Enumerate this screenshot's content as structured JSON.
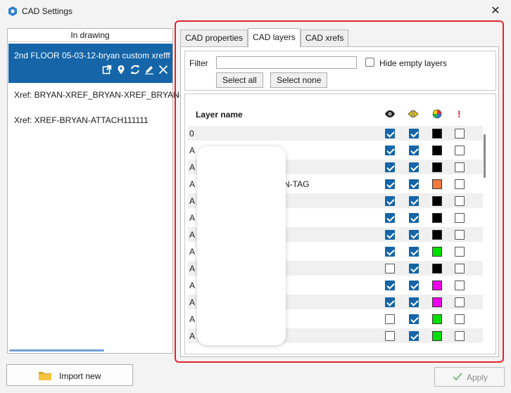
{
  "window": {
    "title": "CAD Settings",
    "close_glyph": "✕"
  },
  "left_panel": {
    "header": "In drawing",
    "selected_xref": "2nd FLOOR 05-03-12-bryan custom xrefff",
    "xref_items": [
      "Xref: BRYAN-XREF_BRYAN-XREF_BRYAN-",
      "Xref: XREF-BRYAN-ATTACH111111"
    ],
    "action_icons": [
      "open-external-icon",
      "locate-pin-icon",
      "reload-icon",
      "edit-pencil-icon",
      "remove-x-icon"
    ]
  },
  "tabs": [
    {
      "label": "CAD properties",
      "active": false
    },
    {
      "label": "CAD layers",
      "active": true
    },
    {
      "label": "CAD xrefs",
      "active": false
    }
  ],
  "filter": {
    "label": "Filter",
    "value": "",
    "hide_empty_label": "Hide empty layers",
    "hide_empty_checked": false,
    "select_all_label": "Select all",
    "select_none_label": "Select none"
  },
  "layers": {
    "header_name": "Layer name",
    "column_icons": [
      "visibility-eye-icon",
      "snap-arrows-icon",
      "color-wheel-icon",
      "warning-exclamation-icon"
    ],
    "rows": [
      {
        "name": "0",
        "visible": true,
        "snap": true,
        "color": "#000000",
        "flag": false
      },
      {
        "name": "A",
        "visible": true,
        "snap": true,
        "color": "#000000",
        "flag": false
      },
      {
        "name": "A",
        "visible": true,
        "snap": true,
        "color": "#000000",
        "flag": false
      },
      {
        "name": "A",
        "suffix": "EN-TAG",
        "visible": true,
        "snap": true,
        "color": "#f07a3a",
        "flag": false
      },
      {
        "name": "A",
        "visible": true,
        "snap": true,
        "color": "#000000",
        "flag": false
      },
      {
        "name": "A",
        "visible": true,
        "snap": true,
        "color": "#000000",
        "flag": false
      },
      {
        "name": "A",
        "visible": true,
        "snap": true,
        "color": "#000000",
        "flag": false
      },
      {
        "name": "A",
        "visible": true,
        "snap": true,
        "color": "#00e000",
        "flag": false
      },
      {
        "name": "A",
        "visible": false,
        "snap": true,
        "color": "#000000",
        "flag": false
      },
      {
        "name": "A",
        "visible": true,
        "snap": true,
        "color": "#ee00ee",
        "flag": false
      },
      {
        "name": "A",
        "visible": true,
        "snap": true,
        "color": "#ee00ee",
        "flag": false
      },
      {
        "name": "A",
        "visible": false,
        "snap": true,
        "color": "#00e000",
        "flag": false
      },
      {
        "name": "A",
        "visible": false,
        "snap": true,
        "color": "#00e000",
        "flag": false
      }
    ]
  },
  "footer": {
    "import_label": "Import new",
    "apply_label": "Apply"
  },
  "colors": {
    "accent": "#1565a8",
    "highlight_frame": "#e0262a"
  }
}
